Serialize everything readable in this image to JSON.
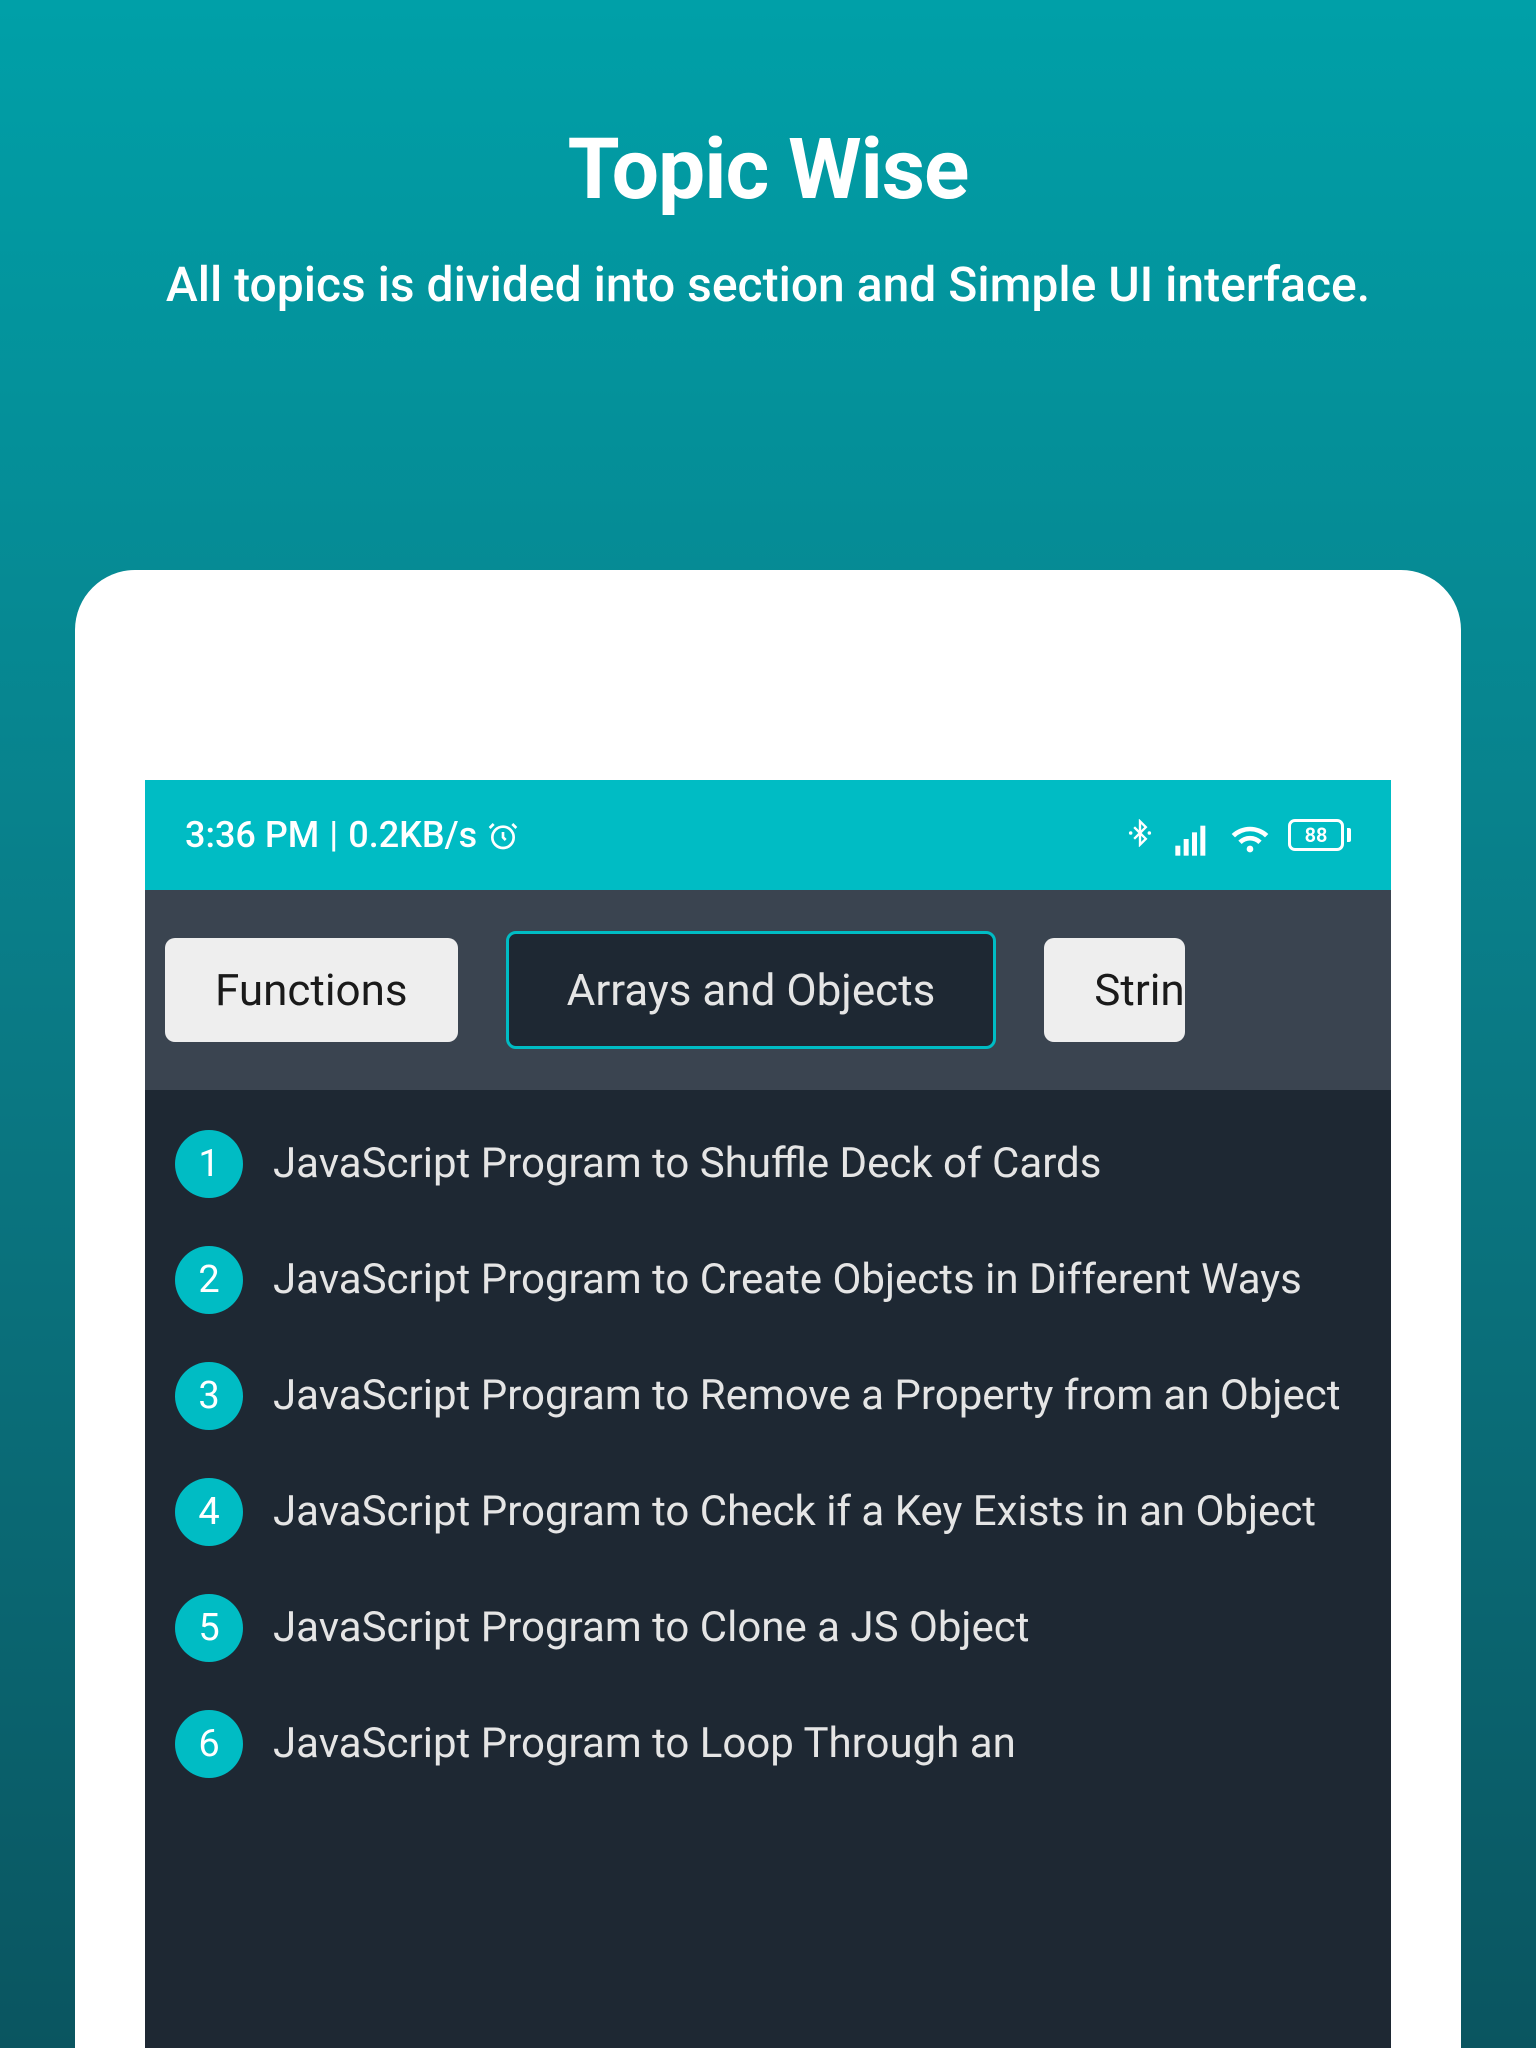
{
  "promo": {
    "title": "Topic Wise",
    "subtitle": "All topics is divided into section and Simple UI interface."
  },
  "status_bar": {
    "time": "3:36 PM",
    "data_speed": "0.2KB/s",
    "battery": "88"
  },
  "tabs": [
    {
      "label": "Functions",
      "active": false
    },
    {
      "label": "Arrays and Objects",
      "active": true
    },
    {
      "label": "Strin",
      "active": false
    }
  ],
  "list_items": [
    {
      "num": "1",
      "title": "JavaScript Program to Shuffle Deck of Cards"
    },
    {
      "num": "2",
      "title": "JavaScript Program to Create Objects in Different Ways"
    },
    {
      "num": "3",
      "title": "JavaScript Program to Remove a Property from an Object"
    },
    {
      "num": "4",
      "title": "JavaScript Program to Check if a Key Exists in an Object"
    },
    {
      "num": "5",
      "title": "JavaScript Program to Clone a JS Object"
    },
    {
      "num": "6",
      "title": "JavaScript Program to Loop Through an"
    }
  ]
}
